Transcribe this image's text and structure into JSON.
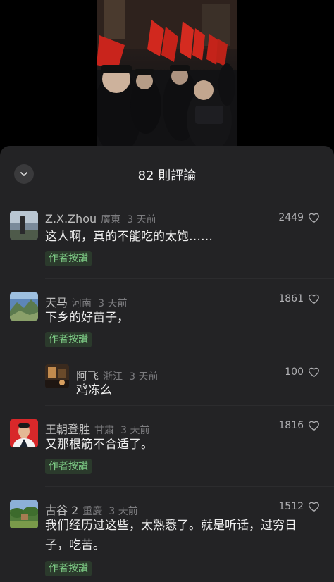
{
  "sheet": {
    "title": "82 則評論"
  },
  "comments": [
    {
      "name": "Z.X.Zhou",
      "location": "廣東",
      "time": "3 天前",
      "likes": "2449",
      "text": "这人啊，真的不能吃的太饱……",
      "tag": "作者按讚"
    },
    {
      "name": "天马",
      "location": "河南",
      "time": "3 天前",
      "likes": "1861",
      "text": "下乡的好苗子，",
      "tag": "作者按讚",
      "reply": {
        "name": "阿飞",
        "location": "浙江",
        "time": "3 天前",
        "likes": "100",
        "text": "鸡冻么"
      }
    },
    {
      "name": "王朝登胜",
      "location": "甘肅",
      "time": "3 天前",
      "likes": "1816",
      "text": "又那根筋不合适了。",
      "tag": "作者按讚"
    },
    {
      "name": "古谷 2",
      "location": "重慶",
      "time": "3 天前",
      "likes": "1512",
      "text_line1": "我们经历过这些，太熟悉了。就是听话，过穷日",
      "text_line2": "子，吃苦。",
      "tag": "作者按讚"
    }
  ],
  "icons": {
    "collapse": "chevron-down-icon",
    "like": "heart-outline-icon"
  },
  "colors": {
    "sheet_bg": "#232325",
    "author_tag": "#7fcf87"
  }
}
